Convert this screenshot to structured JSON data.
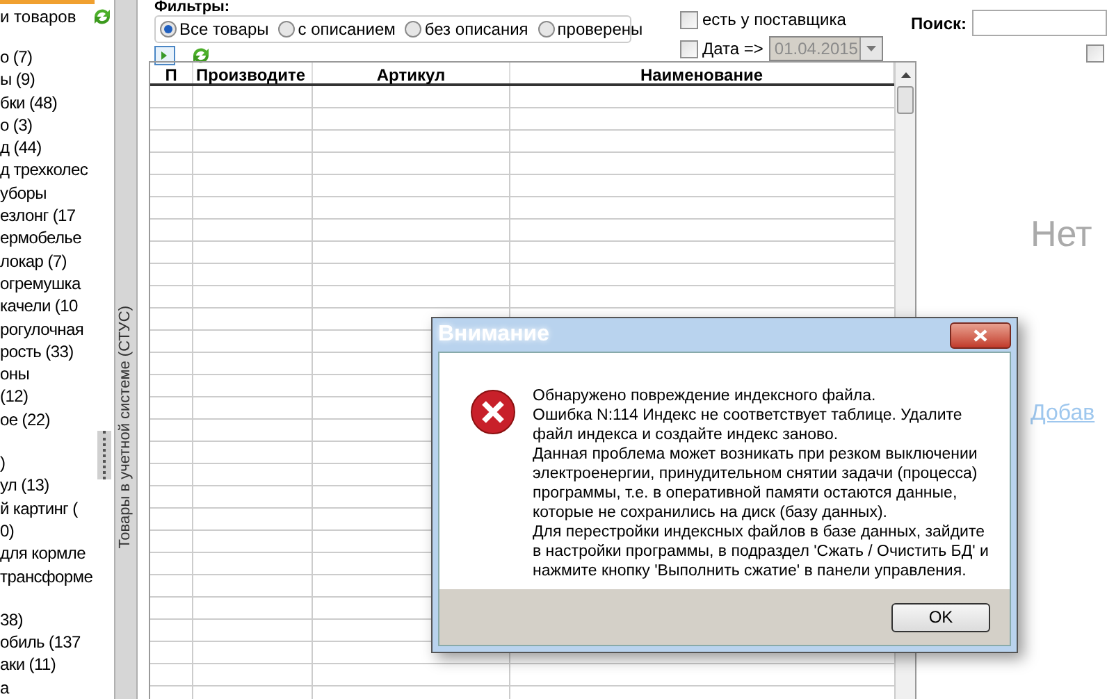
{
  "sidebar": {
    "title": "и товаров",
    "groups": [
      {
        "items": [
          "о (7)",
          "ы (9)",
          "бки (48)",
          "о (3)",
          "д (44)",
          "д трехколес",
          "уборы",
          "езлонг (17",
          "ермобелье",
          "локар (7)",
          "огремушка",
          "качели (10",
          "рогулочная",
          "рость (33)",
          "оны",
          "(12)",
          "ое (22)"
        ]
      },
      {
        "items": [
          ")",
          "ул (13)",
          "й картинг (",
          "0)",
          "для кормле",
          "трансформе"
        ]
      },
      {
        "items": [
          "38)",
          "обиль (137",
          "аки (11)",
          "а"
        ]
      }
    ]
  },
  "side_tab": {
    "label": "Товары в учетной системе (СТУС)"
  },
  "filters": {
    "label": "Фильтры:",
    "options": [
      {
        "label": "Все товары",
        "selected": true
      },
      {
        "label": "с описанием",
        "selected": false
      },
      {
        "label": "без описания",
        "selected": false
      },
      {
        "label": "проверены",
        "selected": false
      }
    ]
  },
  "supplier": {
    "label": "есть у поставщика",
    "checked": false
  },
  "date": {
    "label": "Дата =>",
    "checked": false,
    "value": "01.04.2015",
    "disabled": true
  },
  "search": {
    "label": "Поиск:",
    "option_checked": false
  },
  "table": {
    "columns": [
      "П",
      "Производите",
      "Артикул",
      "Наименование"
    ]
  },
  "right_panel": {
    "message": "Нет",
    "link": "Добав"
  },
  "dialog": {
    "title": "Внимание",
    "message": "Обнаружено повреждение индексного файла.\nОшибка N:114 Индекс не соответствует таблице. Удалите\nфайл индекса и создайте индекс заново.\nДанная проблема может возникать при резком выключении\nэлектроенергии, принудительном снятии задачи (процесса)\nпрограммы, т.е. в оперативной памяти остаются данные,\nкоторые не сохранились на диск (базу данных).\nДля перестройки индексных файлов в базе данных, зайдите\nв настройки программы, в подраздел 'Сжать / Очистить БД' и\nнажмите кнопку 'Выполнить сжатие' в панели управления.",
    "button": "OK"
  }
}
